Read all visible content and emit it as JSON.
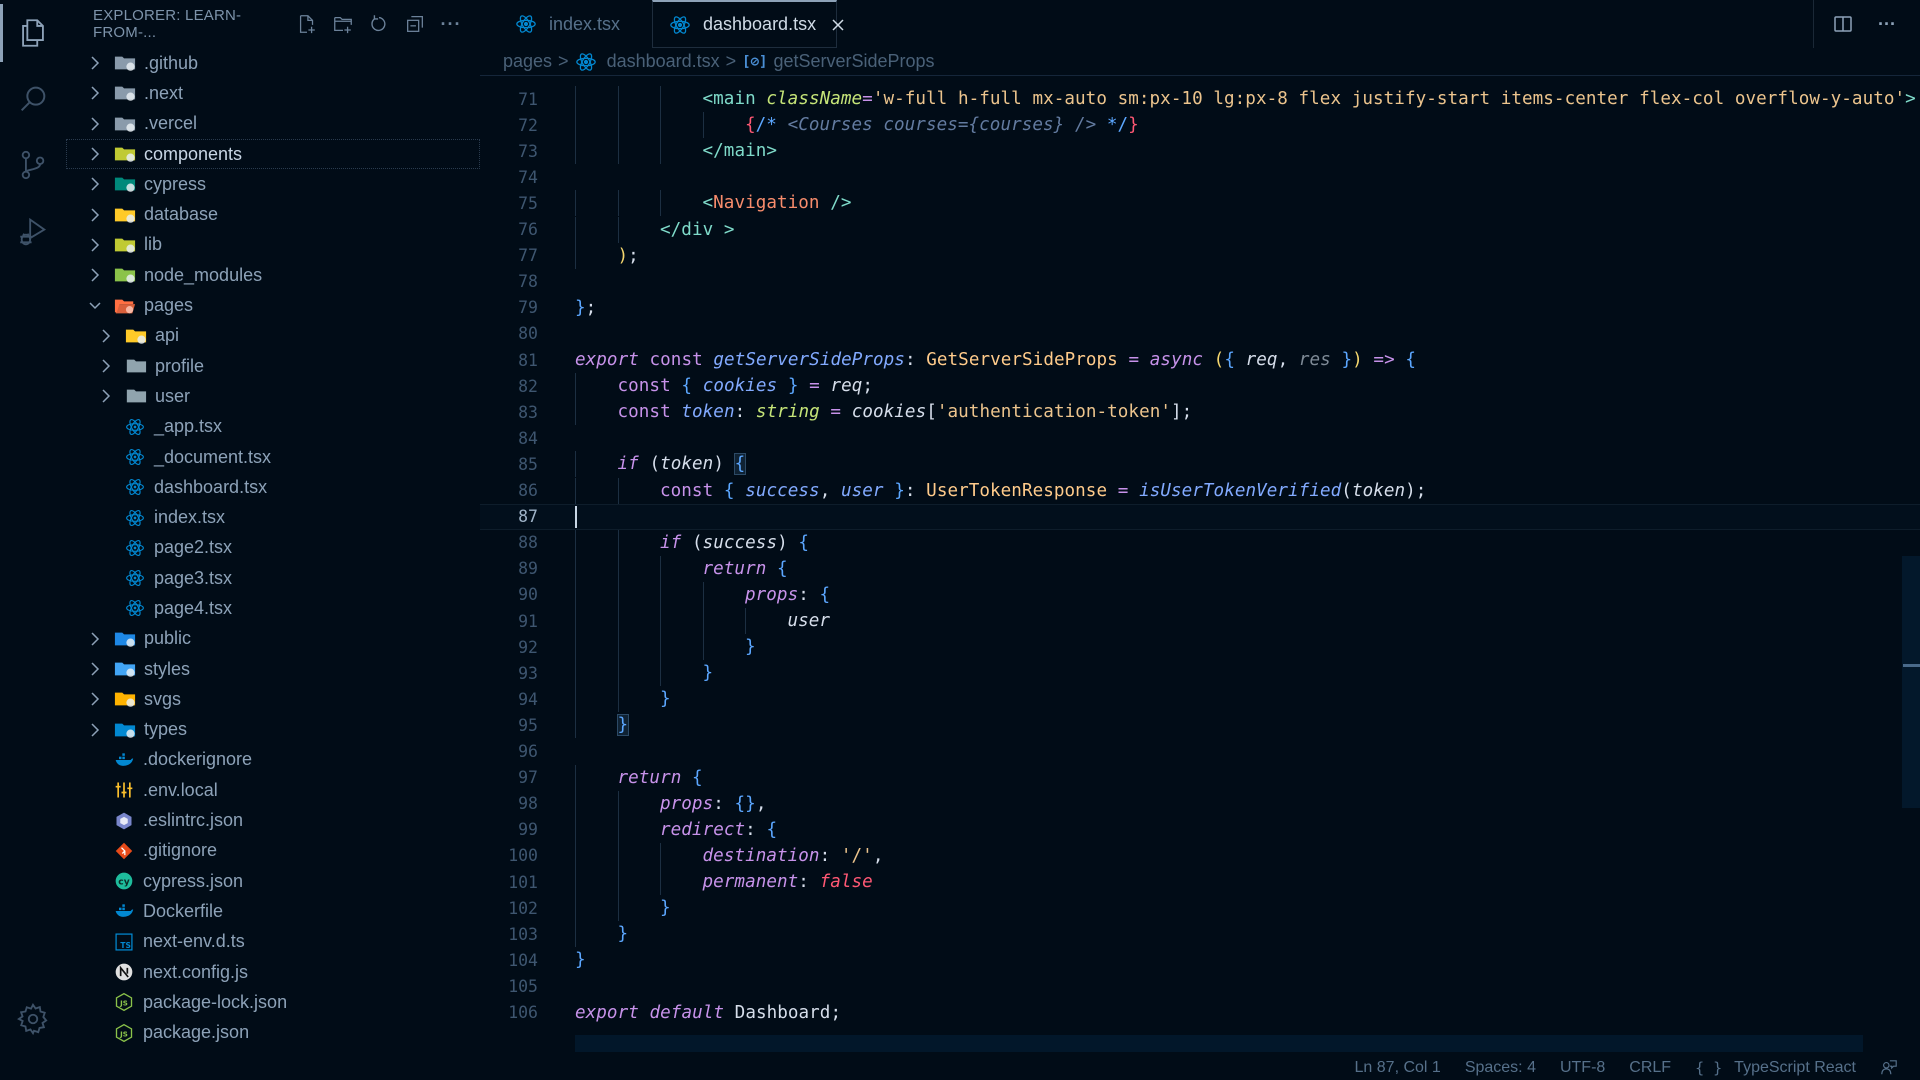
{
  "activity_bar": {
    "items": [
      {
        "name": "explorer",
        "icon": "files-icon",
        "active": true
      },
      {
        "name": "search",
        "icon": "search-icon",
        "active": false
      },
      {
        "name": "source-control",
        "icon": "source-control-icon",
        "active": false
      },
      {
        "name": "run-debug",
        "icon": "run-debug-icon",
        "active": false
      }
    ],
    "bottom": [
      {
        "name": "settings",
        "icon": "gear-icon"
      }
    ]
  },
  "sidebar": {
    "title": "EXPLORER: LEARN-FROM-...",
    "actions": [
      "new-file-icon",
      "new-folder-icon",
      "refresh-icon",
      "collapse-all-icon",
      "more-icon"
    ],
    "more_label": "···",
    "tree": [
      {
        "label": ".github",
        "type": "folder",
        "depth": 0,
        "expanded": false,
        "icon": "folder-github-icon",
        "color": "#8a9bab"
      },
      {
        "label": ".next",
        "type": "folder",
        "depth": 0,
        "expanded": false,
        "icon": "folder-next-icon",
        "color": "#8a9bab"
      },
      {
        "label": ".vercel",
        "type": "folder",
        "depth": 0,
        "expanded": false,
        "icon": "folder-vercel-icon",
        "color": "#8a9bab"
      },
      {
        "label": "components",
        "type": "folder",
        "depth": 0,
        "expanded": false,
        "icon": "folder-components-icon",
        "color": "#c0ca33",
        "focused": true
      },
      {
        "label": "cypress",
        "type": "folder",
        "depth": 0,
        "expanded": false,
        "icon": "folder-cypress-icon",
        "color": "#00897b"
      },
      {
        "label": "database",
        "type": "folder",
        "depth": 0,
        "expanded": false,
        "icon": "folder-database-icon",
        "color": "#ffca28"
      },
      {
        "label": "lib",
        "type": "folder",
        "depth": 0,
        "expanded": false,
        "icon": "folder-lib-icon",
        "color": "#c0ca33"
      },
      {
        "label": "node_modules",
        "type": "folder",
        "depth": 0,
        "expanded": false,
        "icon": "folder-node-icon",
        "color": "#8bc34a"
      },
      {
        "label": "pages",
        "type": "folder",
        "depth": 0,
        "expanded": true,
        "icon": "folder-pages-open-icon",
        "color": "#ff7043"
      },
      {
        "label": "api",
        "type": "folder",
        "depth": 1,
        "expanded": false,
        "icon": "folder-api-icon",
        "color": "#ffca28"
      },
      {
        "label": "profile",
        "type": "folder",
        "depth": 1,
        "expanded": false,
        "icon": "folder-icon",
        "color": "#90a4ae"
      },
      {
        "label": "user",
        "type": "folder",
        "depth": 1,
        "expanded": false,
        "icon": "folder-icon",
        "color": "#90a4ae"
      },
      {
        "label": "_app.tsx",
        "type": "file",
        "depth": 1,
        "icon": "react-icon",
        "color": "#0288d1"
      },
      {
        "label": "_document.tsx",
        "type": "file",
        "depth": 1,
        "icon": "react-icon",
        "color": "#0288d1"
      },
      {
        "label": "dashboard.tsx",
        "type": "file",
        "depth": 1,
        "icon": "react-icon",
        "color": "#0288d1"
      },
      {
        "label": "index.tsx",
        "type": "file",
        "depth": 1,
        "icon": "react-icon",
        "color": "#0288d1"
      },
      {
        "label": "page2.tsx",
        "type": "file",
        "depth": 1,
        "icon": "react-icon",
        "color": "#0288d1"
      },
      {
        "label": "page3.tsx",
        "type": "file",
        "depth": 1,
        "icon": "react-icon",
        "color": "#0288d1"
      },
      {
        "label": "page4.tsx",
        "type": "file",
        "depth": 1,
        "icon": "react-icon",
        "color": "#0288d1"
      },
      {
        "label": "public",
        "type": "folder",
        "depth": 0,
        "expanded": false,
        "icon": "folder-public-icon",
        "color": "#1e88e5"
      },
      {
        "label": "styles",
        "type": "folder",
        "depth": 0,
        "expanded": false,
        "icon": "folder-styles-icon",
        "color": "#42a5f5"
      },
      {
        "label": "svgs",
        "type": "folder",
        "depth": 0,
        "expanded": false,
        "icon": "folder-svg-icon",
        "color": "#ffb300"
      },
      {
        "label": "types",
        "type": "folder",
        "depth": 0,
        "expanded": false,
        "icon": "folder-typescript-icon",
        "color": "#0288d1"
      },
      {
        "label": ".dockerignore",
        "type": "file",
        "depth": 0,
        "icon": "docker-icon",
        "color": "#0288d1"
      },
      {
        "label": ".env.local",
        "type": "file",
        "depth": 0,
        "icon": "tune-icon",
        "color": "#fbc02d"
      },
      {
        "label": ".eslintrc.json",
        "type": "file",
        "depth": 0,
        "icon": "eslint-icon",
        "color": "#7986cb"
      },
      {
        "label": ".gitignore",
        "type": "file",
        "depth": 0,
        "icon": "git-icon",
        "color": "#e64a19"
      },
      {
        "label": "cypress.json",
        "type": "file",
        "depth": 0,
        "icon": "cypress-icon",
        "color": "#1ebc9c"
      },
      {
        "label": "Dockerfile",
        "type": "file",
        "depth": 0,
        "icon": "docker-icon",
        "color": "#0288d1"
      },
      {
        "label": "next-env.d.ts",
        "type": "file",
        "depth": 0,
        "icon": "typescript-def-icon",
        "color": "#0288d1"
      },
      {
        "label": "next.config.js",
        "type": "file",
        "depth": 0,
        "icon": "nextjs-icon",
        "color": "#e0e0e0"
      },
      {
        "label": "package-lock.json",
        "type": "file",
        "depth": 0,
        "icon": "nodejs-icon",
        "color": "#8bc34a"
      },
      {
        "label": "package.json",
        "type": "file",
        "depth": 0,
        "icon": "nodejs-icon",
        "color": "#8bc34a"
      }
    ]
  },
  "tabs": [
    {
      "label": "index.tsx",
      "icon": "react-icon",
      "active": false
    },
    {
      "label": "dashboard.tsx",
      "icon": "react-icon",
      "active": true,
      "close_icon": "close-icon"
    }
  ],
  "editor_actions": {
    "split": "split-editor-icon",
    "more": "···"
  },
  "breadcrumbs": {
    "items": [
      "pages",
      "dashboard.tsx",
      "getServerSideProps"
    ],
    "symbol_glyph": "[⊘]",
    "sep": ">"
  },
  "editor": {
    "current_line": 87,
    "lines": [
      {
        "n": 71,
        "indent": 3,
        "tokens": [
          [
            "t-tag",
            "<"
          ],
          [
            "t-tagname",
            "main"
          ],
          [
            "t-plain",
            " "
          ],
          [
            "t-attr",
            "className"
          ],
          [
            "t-op",
            "="
          ],
          [
            "t-str",
            "'w-full h-full mx-auto sm:px-10 lg:px-8 flex justify-start items-center flex-col overflow-y-auto'"
          ],
          [
            "t-tag",
            ">"
          ]
        ]
      },
      {
        "n": 72,
        "indent": 4,
        "tokens": [
          [
            "t-br3",
            "{"
          ],
          [
            "t-br1",
            "/*"
          ],
          [
            "t-com",
            " <Courses courses={courses} /> "
          ],
          [
            "t-br1",
            "*/"
          ],
          [
            "t-br3",
            "}"
          ]
        ]
      },
      {
        "n": 73,
        "indent": 3,
        "tokens": [
          [
            "t-tag",
            "</"
          ],
          [
            "t-tagname",
            "main"
          ],
          [
            "t-tag",
            ">"
          ]
        ]
      },
      {
        "n": 74,
        "indent": 0,
        "tokens": []
      },
      {
        "n": 75,
        "indent": 3,
        "tokens": [
          [
            "t-tag",
            "<"
          ],
          [
            "t-comp",
            "Navigation"
          ],
          [
            "t-plain",
            " "
          ],
          [
            "t-tag",
            "/>"
          ]
        ]
      },
      {
        "n": 76,
        "indent": 2,
        "tokens": [
          [
            "t-tag",
            "</"
          ],
          [
            "t-tagname",
            "div"
          ],
          [
            "t-plain",
            " "
          ],
          [
            "t-tag",
            ">"
          ]
        ]
      },
      {
        "n": 77,
        "indent": 1,
        "tokens": [
          [
            "t-br2",
            ")"
          ],
          [
            "t-plain",
            ";"
          ]
        ]
      },
      {
        "n": 78,
        "indent": 0,
        "tokens": []
      },
      {
        "n": 79,
        "indent": 0,
        "tokens": [
          [
            "t-br1",
            "}"
          ],
          [
            "t-plain",
            ";"
          ]
        ]
      },
      {
        "n": 80,
        "indent": 0,
        "tokens": []
      },
      {
        "n": 81,
        "indent": 0,
        "tokens": [
          [
            "t-kw",
            "export"
          ],
          [
            "t-plain",
            " "
          ],
          [
            "t-kw2",
            "const"
          ],
          [
            "t-plain",
            " "
          ],
          [
            "t-fn",
            "getServerSideProps"
          ],
          [
            "t-plain",
            ": "
          ],
          [
            "t-type",
            "GetServerSideProps"
          ],
          [
            "t-plain",
            " "
          ],
          [
            "t-op",
            "="
          ],
          [
            "t-plain",
            " "
          ],
          [
            "t-kw",
            "async"
          ],
          [
            "t-plain",
            " "
          ],
          [
            "t-br2",
            "("
          ],
          [
            "t-br1",
            "{"
          ],
          [
            "t-plain",
            " "
          ],
          [
            "t-var",
            "req"
          ],
          [
            "t-plain",
            ", "
          ],
          [
            "t-param",
            "res"
          ],
          [
            "t-plain",
            " "
          ],
          [
            "t-br1",
            "}"
          ],
          [
            "t-br2",
            ")"
          ],
          [
            "t-plain",
            " "
          ],
          [
            "t-op",
            "=>"
          ],
          [
            "t-plain",
            " "
          ],
          [
            "t-br1",
            "{"
          ]
        ]
      },
      {
        "n": 82,
        "indent": 1,
        "tokens": [
          [
            "t-kw2",
            "const"
          ],
          [
            "t-plain",
            " "
          ],
          [
            "t-br1",
            "{"
          ],
          [
            "t-plain",
            " "
          ],
          [
            "t-var2",
            "cookies"
          ],
          [
            "t-plain",
            " "
          ],
          [
            "t-br1",
            "}"
          ],
          [
            "t-plain",
            " "
          ],
          [
            "t-op",
            "="
          ],
          [
            "t-plain",
            " "
          ],
          [
            "t-var",
            "req"
          ],
          [
            "t-plain",
            ";"
          ]
        ]
      },
      {
        "n": 83,
        "indent": 1,
        "tokens": [
          [
            "t-kw2",
            "const"
          ],
          [
            "t-plain",
            " "
          ],
          [
            "t-var2",
            "token"
          ],
          [
            "t-plain",
            ": "
          ],
          [
            "t-tstr",
            "string"
          ],
          [
            "t-plain",
            " "
          ],
          [
            "t-op",
            "="
          ],
          [
            "t-plain",
            " "
          ],
          [
            "t-var",
            "cookies"
          ],
          [
            "t-plain",
            "["
          ],
          [
            "t-str",
            "'authentication-token'"
          ],
          [
            "t-plain",
            "];"
          ]
        ]
      },
      {
        "n": 84,
        "indent": 0,
        "tokens": []
      },
      {
        "n": 85,
        "indent": 1,
        "tokens": [
          [
            "t-kw",
            "if"
          ],
          [
            "t-plain",
            " ("
          ],
          [
            "t-var",
            "token"
          ],
          [
            "t-plain",
            ") "
          ],
          [
            "t-br1 bmatch",
            "{"
          ]
        ]
      },
      {
        "n": 86,
        "indent": 2,
        "tokens": [
          [
            "t-kw2",
            "const"
          ],
          [
            "t-plain",
            " "
          ],
          [
            "t-br1",
            "{"
          ],
          [
            "t-plain",
            " "
          ],
          [
            "t-var2",
            "success"
          ],
          [
            "t-plain",
            ", "
          ],
          [
            "t-var2",
            "user"
          ],
          [
            "t-plain",
            " "
          ],
          [
            "t-br1",
            "}"
          ],
          [
            "t-plain",
            ": "
          ],
          [
            "t-type",
            "UserTokenResponse"
          ],
          [
            "t-plain",
            " "
          ],
          [
            "t-op",
            "="
          ],
          [
            "t-plain",
            " "
          ],
          [
            "t-fn",
            "isUserTokenVerified"
          ],
          [
            "t-plain",
            "("
          ],
          [
            "t-var",
            "token"
          ],
          [
            "t-plain",
            ");"
          ]
        ]
      },
      {
        "n": 87,
        "indent": 0,
        "tokens": []
      },
      {
        "n": 88,
        "indent": 2,
        "tokens": [
          [
            "t-kw",
            "if"
          ],
          [
            "t-plain",
            " ("
          ],
          [
            "t-var",
            "success"
          ],
          [
            "t-plain",
            ") "
          ],
          [
            "t-br1",
            "{"
          ]
        ]
      },
      {
        "n": 89,
        "indent": 3,
        "tokens": [
          [
            "t-kw",
            "return"
          ],
          [
            "t-plain",
            " "
          ],
          [
            "t-br1",
            "{"
          ]
        ]
      },
      {
        "n": 90,
        "indent": 4,
        "tokens": [
          [
            "t-prop",
            "props"
          ],
          [
            "t-plain",
            ": "
          ],
          [
            "t-br1",
            "{"
          ]
        ]
      },
      {
        "n": 91,
        "indent": 5,
        "tokens": [
          [
            "t-var",
            "user"
          ]
        ]
      },
      {
        "n": 92,
        "indent": 4,
        "tokens": [
          [
            "t-br1",
            "}"
          ]
        ]
      },
      {
        "n": 93,
        "indent": 3,
        "tokens": [
          [
            "t-br1",
            "}"
          ]
        ]
      },
      {
        "n": 94,
        "indent": 2,
        "tokens": [
          [
            "t-br1",
            "}"
          ]
        ]
      },
      {
        "n": 95,
        "indent": 1,
        "tokens": [
          [
            "t-br1 bmatch",
            "}"
          ]
        ]
      },
      {
        "n": 96,
        "indent": 0,
        "tokens": []
      },
      {
        "n": 97,
        "indent": 1,
        "tokens": [
          [
            "t-kw",
            "return"
          ],
          [
            "t-plain",
            " "
          ],
          [
            "t-br1",
            "{"
          ]
        ]
      },
      {
        "n": 98,
        "indent": 2,
        "tokens": [
          [
            "t-prop",
            "props"
          ],
          [
            "t-plain",
            ": "
          ],
          [
            "t-br1",
            "{}"
          ],
          [
            "t-plain",
            ","
          ]
        ]
      },
      {
        "n": 99,
        "indent": 2,
        "tokens": [
          [
            "t-prop",
            "redirect"
          ],
          [
            "t-plain",
            ": "
          ],
          [
            "t-br1",
            "{"
          ]
        ]
      },
      {
        "n": 100,
        "indent": 3,
        "tokens": [
          [
            "t-prop",
            "destination"
          ],
          [
            "t-plain",
            ": "
          ],
          [
            "t-str",
            "'/'"
          ],
          [
            "t-plain",
            ","
          ]
        ]
      },
      {
        "n": 101,
        "indent": 3,
        "tokens": [
          [
            "t-prop",
            "permanent"
          ],
          [
            "t-plain",
            ": "
          ],
          [
            "t-bool",
            "false"
          ]
        ]
      },
      {
        "n": 102,
        "indent": 2,
        "tokens": [
          [
            "t-br1",
            "}"
          ]
        ]
      },
      {
        "n": 103,
        "indent": 1,
        "tokens": [
          [
            "t-br1",
            "}"
          ]
        ]
      },
      {
        "n": 104,
        "indent": 0,
        "tokens": [
          [
            "t-br1",
            "}"
          ]
        ]
      },
      {
        "n": 105,
        "indent": 0,
        "tokens": []
      },
      {
        "n": 106,
        "indent": 0,
        "tokens": [
          [
            "t-kw",
            "export"
          ],
          [
            "t-plain",
            " "
          ],
          [
            "t-kw",
            "default"
          ],
          [
            "t-plain",
            " "
          ],
          [
            "t-plain",
            "Dashboard"
          ],
          [
            "t-plain",
            ";"
          ]
        ]
      }
    ]
  },
  "statusbar": {
    "position": "Ln 87, Col 1",
    "spaces": "Spaces: 4",
    "encoding": "UTF-8",
    "eol": "CRLF",
    "language_glyph": "{ }",
    "language": "TypeScript React",
    "feedback_icon": "feedback-icon"
  }
}
